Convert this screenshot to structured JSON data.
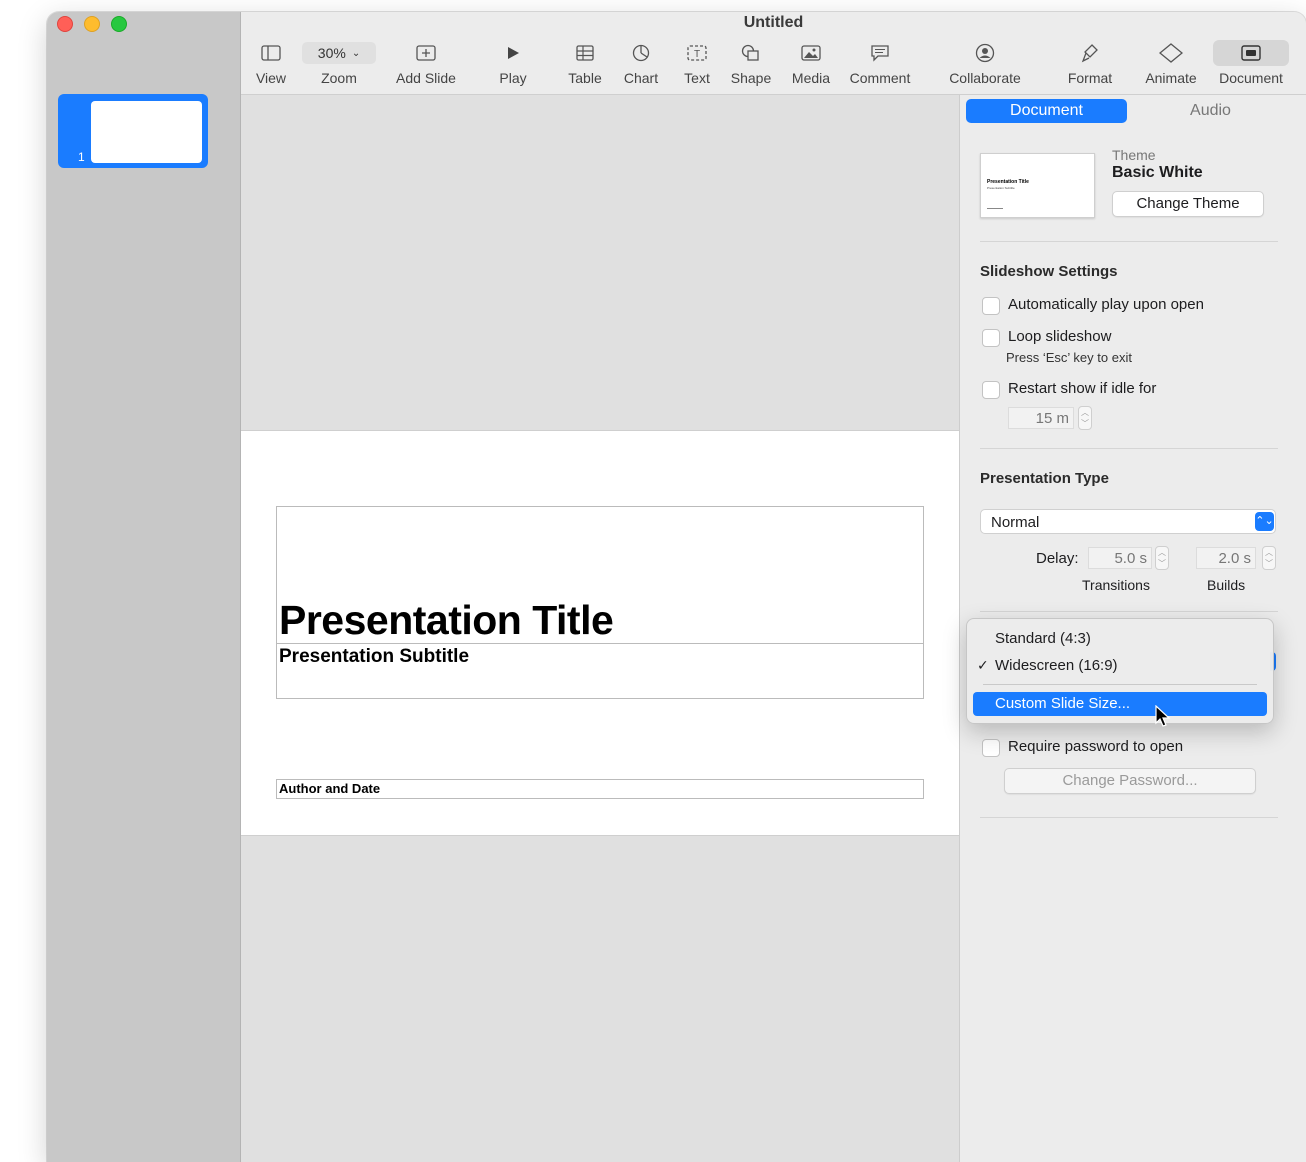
{
  "window": {
    "title": "Untitled"
  },
  "slides": [
    {
      "number": "1"
    }
  ],
  "toolbar": {
    "view": "View",
    "zoom_value": "30%",
    "zoom": "Zoom",
    "add_slide": "Add Slide",
    "play": "Play",
    "table": "Table",
    "chart": "Chart",
    "text": "Text",
    "shape": "Shape",
    "media": "Media",
    "comment": "Comment",
    "collaborate": "Collaborate",
    "format": "Format",
    "animate": "Animate",
    "document": "Document"
  },
  "slide": {
    "title": "Presentation Title",
    "subtitle": "Presentation Subtitle",
    "author": "Author and Date"
  },
  "inspector": {
    "tabs": {
      "document": "Document",
      "audio": "Audio"
    },
    "theme": {
      "label": "Theme",
      "name": "Basic White",
      "change_button": "Change Theme",
      "thumb_title": "Presentation Title",
      "thumb_subtitle": "Presentation Subtitle"
    },
    "slideshow": {
      "heading": "Slideshow Settings",
      "autoplay": "Automatically play upon open",
      "loop": "Loop slideshow",
      "loop_note": "Press ‘Esc’ key to exit",
      "restart": "Restart show if idle for",
      "idle_value": "15 m"
    },
    "presentation_type": {
      "heading": "Presentation Type",
      "selected": "Normal",
      "delay_label": "Delay:",
      "transitions_value": "5.0 s",
      "builds_value": "2.0 s",
      "transitions_label": "Transitions",
      "builds_label": "Builds"
    },
    "password": {
      "require": "Require password to open",
      "change_button": "Change Password..."
    }
  },
  "slide_size_menu": {
    "items": [
      "Standard (4:3)",
      "Widescreen (16:9)"
    ],
    "checked": "✓",
    "highlighted": "Custom Slide Size..."
  },
  "colors": {
    "accent": "#1a7cff"
  }
}
